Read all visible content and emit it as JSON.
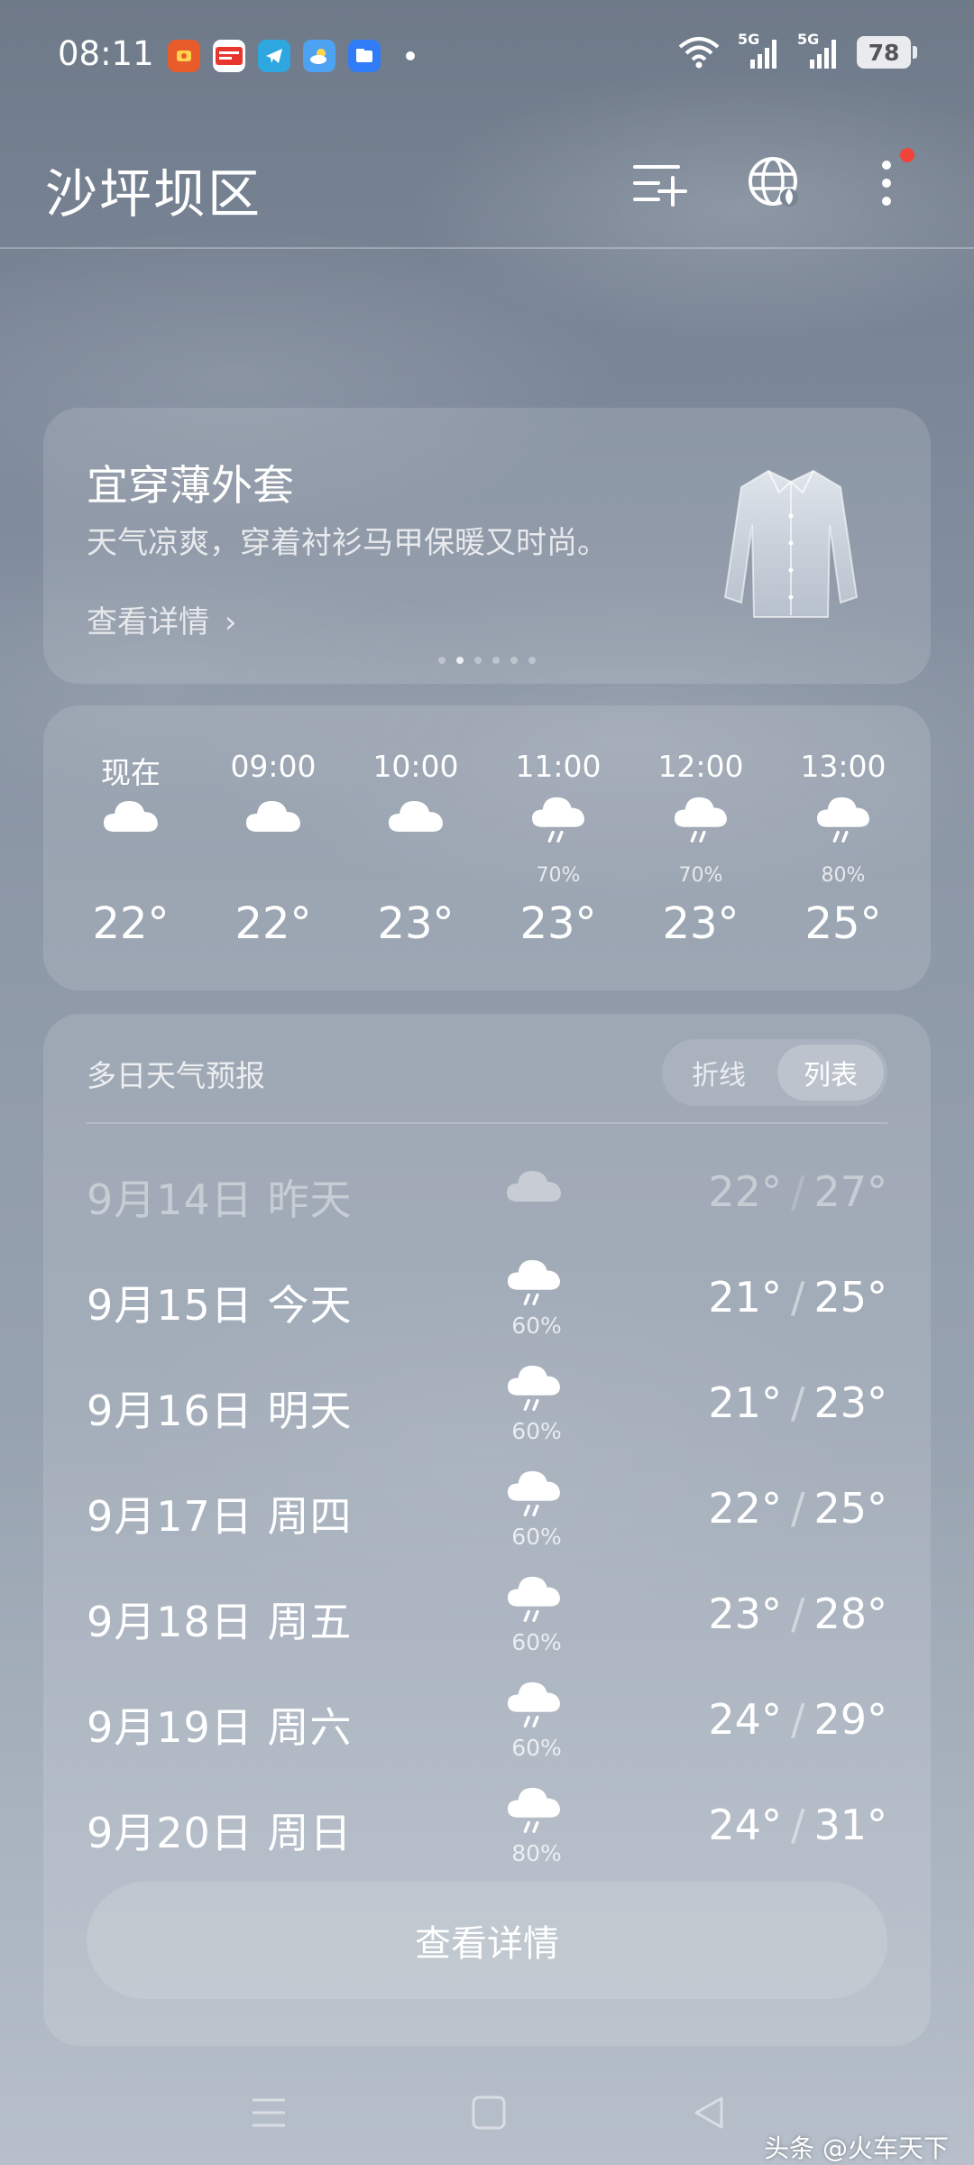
{
  "status_bar": {
    "time": "08:11",
    "battery": "78",
    "app_icons": [
      "app-red-icon",
      "toutiao-icon",
      "telegram-icon",
      "weather-icon",
      "files-icon"
    ],
    "signal_labels": [
      "5G",
      "5G"
    ]
  },
  "header": {
    "city": "沙坪坝区",
    "icons": [
      "manage-cities-icon",
      "globe-icon",
      "more-icon"
    ]
  },
  "dress_card": {
    "title": "宜穿薄外套",
    "description": "天气凉爽，穿着衬衫马甲保暖又时尚。",
    "link": "查看详情",
    "link_arrow": "›",
    "pager_count": 6,
    "pager_active": 1
  },
  "hourly": [
    {
      "time": "现在",
      "icon": "cloud",
      "prob": "",
      "temp": "22°"
    },
    {
      "time": "09:00",
      "icon": "cloud",
      "prob": "",
      "temp": "22°"
    },
    {
      "time": "10:00",
      "icon": "cloud",
      "prob": "",
      "temp": "23°"
    },
    {
      "time": "11:00",
      "icon": "rain",
      "prob": "70%",
      "temp": "23°"
    },
    {
      "time": "12:00",
      "icon": "rain",
      "prob": "70%",
      "temp": "23°"
    },
    {
      "time": "13:00",
      "icon": "rain",
      "prob": "80%",
      "temp": "25°"
    }
  ],
  "forecast": {
    "title": "多日天气预报",
    "toggle": {
      "line": "折线",
      "list": "列表",
      "selected": "列表"
    },
    "days": [
      {
        "date": "9月14日",
        "label": "昨天",
        "icon": "cloud",
        "prob": "",
        "low": "22°",
        "high": "27°",
        "past": true
      },
      {
        "date": "9月15日",
        "label": "今天",
        "icon": "rain",
        "prob": "60%",
        "low": "21°",
        "high": "25°",
        "past": false
      },
      {
        "date": "9月16日",
        "label": "明天",
        "icon": "rain",
        "prob": "60%",
        "low": "21°",
        "high": "23°",
        "past": false
      },
      {
        "date": "9月17日",
        "label": "周四",
        "icon": "rain",
        "prob": "60%",
        "low": "22°",
        "high": "25°",
        "past": false
      },
      {
        "date": "9月18日",
        "label": "周五",
        "icon": "rain",
        "prob": "60%",
        "low": "23°",
        "high": "28°",
        "past": false
      },
      {
        "date": "9月19日",
        "label": "周六",
        "icon": "rain",
        "prob": "60%",
        "low": "24°",
        "high": "29°",
        "past": false
      },
      {
        "date": "9月20日",
        "label": "周日",
        "icon": "rain",
        "prob": "80%",
        "low": "24°",
        "high": "31°",
        "past": false
      }
    ],
    "details_button": "查看详情"
  },
  "navbar": {
    "icons": [
      "menu-nav-icon",
      "home-nav-icon",
      "back-nav-icon"
    ]
  },
  "watermark": "头条 @火车天下",
  "colors": {
    "alert_dot": "#f0443a",
    "toutiao_red": "#e8362f"
  }
}
